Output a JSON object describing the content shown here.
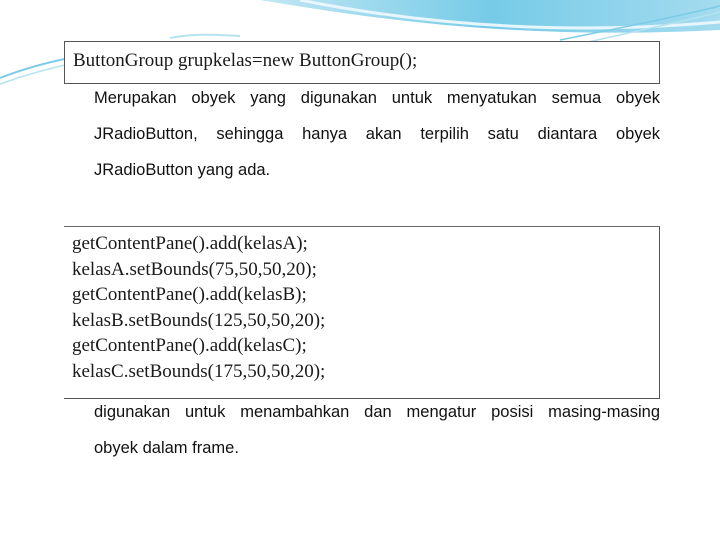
{
  "slide": {
    "accent_color": "#5bc0e0",
    "code_block_1": [
      "ButtonGroup grupkelas=new ButtonGroup();"
    ],
    "description_1": [
      "Merupakan obyek yang digunakan untuk menyatukan semua obyek",
      "JRadioButton, sehingga hanya akan terpilih satu diantara obyek",
      "JRadioButton yang ada."
    ],
    "code_block_2": [
      "getContentPane().add(kelasA);",
      "kelasA.setBounds(75,50,50,20);",
      "getContentPane().add(kelasB);",
      "kelasB.setBounds(125,50,50,20);",
      "getContentPane().add(kelasC);",
      "kelasC.setBounds(175,50,50,20);"
    ],
    "description_2": [
      "digunakan untuk menambahkan dan mengatur posisi masing-masing",
      "obyek dalam frame."
    ]
  }
}
